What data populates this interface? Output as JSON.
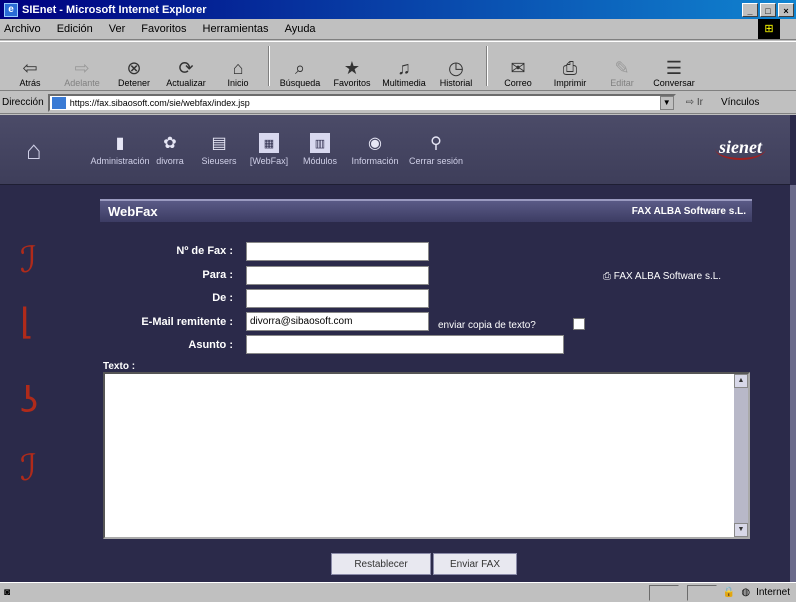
{
  "window": {
    "title": "SIEnet - Microsoft Internet Explorer",
    "controls": [
      "_",
      "□",
      "×"
    ]
  },
  "menu": [
    "Archivo",
    "Edición",
    "Ver",
    "Favoritos",
    "Herramientas",
    "Ayuda"
  ],
  "toolbar": [
    {
      "label": "Atrás",
      "icon": "back-arrow-icon",
      "glyph": "⇦"
    },
    {
      "label": "Adelante",
      "icon": "forward-arrow-icon",
      "glyph": "⇨",
      "disabled": true
    },
    {
      "label": "Detener",
      "icon": "stop-icon",
      "glyph": "⊗"
    },
    {
      "label": "Actualizar",
      "icon": "refresh-icon",
      "glyph": "⟳"
    },
    {
      "label": "Inicio",
      "icon": "home-icon",
      "glyph": "⌂"
    },
    {
      "label": "Búsqueda",
      "icon": "search-icon",
      "glyph": "⌕"
    },
    {
      "label": "Favoritos",
      "icon": "favorites-icon",
      "glyph": "★"
    },
    {
      "label": "Multimedia",
      "icon": "multimedia-icon",
      "glyph": "♫"
    },
    {
      "label": "Historial",
      "icon": "history-icon",
      "glyph": "◷"
    },
    {
      "label": "Correo",
      "icon": "mail-icon",
      "glyph": "✉"
    },
    {
      "label": "Imprimir",
      "icon": "print-icon",
      "glyph": "⎙"
    },
    {
      "label": "Editar",
      "icon": "edit-icon",
      "glyph": "✎",
      "disabled": true
    },
    {
      "label": "Conversar",
      "icon": "discuss-icon",
      "glyph": "☰"
    }
  ],
  "address": {
    "label": "Dirección",
    "url": "https://fax.sibaosoft.com/sie/webfax/index.jsp",
    "go": "Ir",
    "links": "Vínculos"
  },
  "nav": {
    "items": [
      {
        "label": "Administración",
        "glyph": "▮",
        "icon": "administration-icon"
      },
      {
        "label": "divorra",
        "glyph": "✿",
        "icon": "user-icon"
      },
      {
        "label": "Sieusers",
        "glyph": "▤",
        "icon": "sieusers-icon"
      },
      {
        "label": "[WebFax]",
        "glyph": "▦",
        "icon": "webfax-icon",
        "square": true
      },
      {
        "label": "Módulos",
        "glyph": "▥",
        "icon": "modules-icon",
        "square": true
      },
      {
        "label": "Información",
        "glyph": "◉",
        "icon": "information-icon"
      },
      {
        "label": "Cerrar sesión",
        "glyph": "⚲",
        "icon": "logout-icon"
      }
    ],
    "logo": "sienet"
  },
  "panel": {
    "title": "WebFax",
    "company": "FAX ALBA Software s.L."
  },
  "form": {
    "fax_label": "Nº de Fax :",
    "para_label": "Para :",
    "de_label": "De :",
    "email_label": "E-Mail remitente :",
    "email_value": "divorra@sibaosoft.com",
    "copy_label": "enviar copia de texto?",
    "asunto_label": "Asunto :",
    "texto_label": "Texto :",
    "printer_label": "FAX ALBA Software s.L."
  },
  "buttons": {
    "reset": "Restablecer",
    "send": "Enviar FAX"
  },
  "status": {
    "zone": "Internet"
  }
}
